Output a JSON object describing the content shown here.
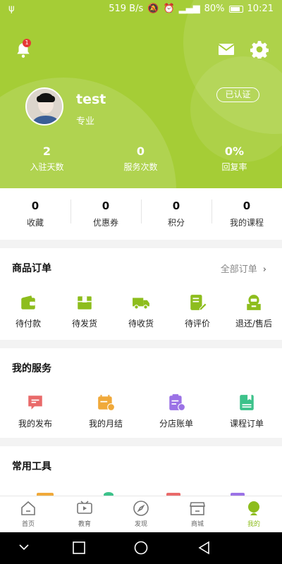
{
  "colors": {
    "accent": "#a5cd36",
    "accent_dark": "#8dbd1d",
    "badge": "#e53935"
  },
  "status_bar": {
    "left_icon": "usb-icon",
    "net_speed": "519 B/s",
    "battery": "80%",
    "time": "10:21"
  },
  "header": {
    "notification_count": "1",
    "username": "test",
    "tag": "专业",
    "verified_label": "已认证",
    "stats": [
      {
        "value": "2",
        "label": "入驻天数"
      },
      {
        "value": "0",
        "label": "服务次数"
      },
      {
        "value": "0%",
        "label": "回复率"
      }
    ]
  },
  "summary": [
    {
      "value": "0",
      "label": "收藏"
    },
    {
      "value": "0",
      "label": "优惠券"
    },
    {
      "value": "0",
      "label": "积分"
    },
    {
      "value": "0",
      "label": "我的课程"
    }
  ],
  "orders": {
    "title": "商品订单",
    "all_label": "全部订单",
    "chevron": "›",
    "items": [
      {
        "label": "待付款",
        "icon": "wallet-icon"
      },
      {
        "label": "待发货",
        "icon": "package-icon"
      },
      {
        "label": "待收货",
        "icon": "truck-icon"
      },
      {
        "label": "待评价",
        "icon": "review-icon"
      },
      {
        "label": "退还/售后",
        "icon": "refund-icon"
      }
    ]
  },
  "services": {
    "title": "我的服务",
    "items": [
      {
        "label": "我的发布",
        "icon": "publish-icon",
        "color": "#e96a6a"
      },
      {
        "label": "我的月结",
        "icon": "calendar-icon",
        "color": "#f0a93a"
      },
      {
        "label": "分店账单",
        "icon": "bill-icon",
        "color": "#9b72e6"
      },
      {
        "label": "课程订单",
        "icon": "course-icon",
        "color": "#3cc28a"
      }
    ]
  },
  "tools": {
    "title": "常用工具"
  },
  "tabbar": [
    {
      "label": "首页",
      "icon": "home-icon"
    },
    {
      "label": "教育",
      "icon": "video-icon"
    },
    {
      "label": "发现",
      "icon": "compass-icon"
    },
    {
      "label": "商城",
      "icon": "store-icon"
    },
    {
      "label": "我的",
      "icon": "profile-icon",
      "active": true
    }
  ]
}
